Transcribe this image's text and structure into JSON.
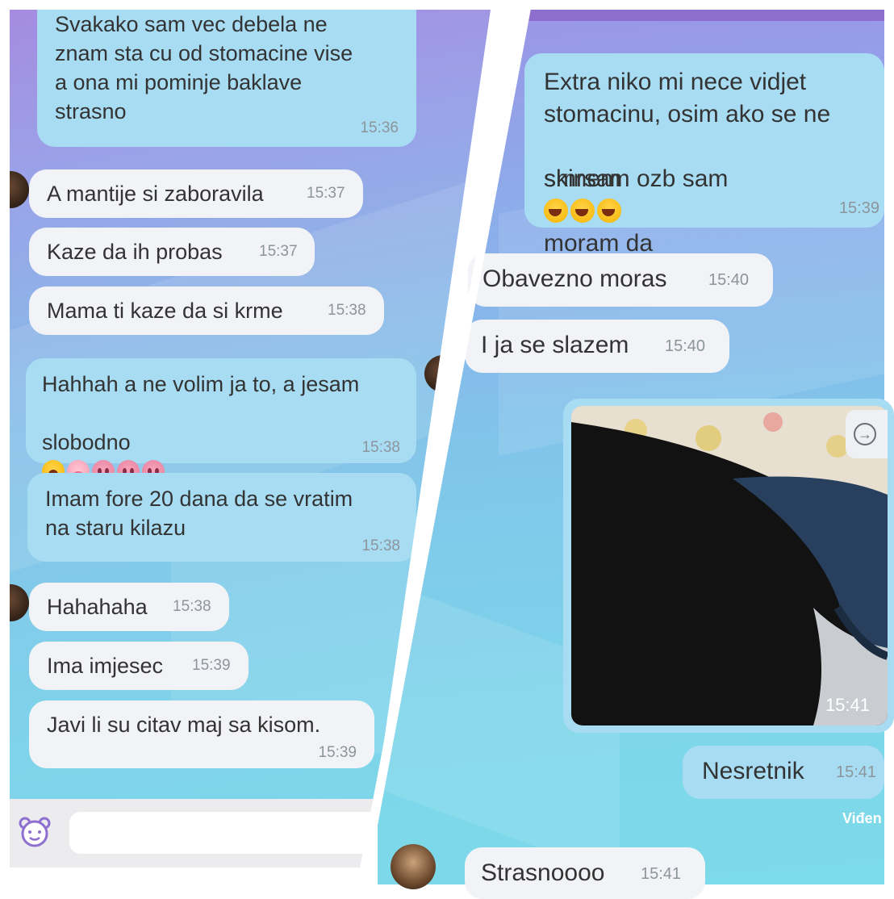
{
  "left_panel": {
    "messages": [
      {
        "text": "Svakako sam vec debela ne\nznam sta cu od stomacine vise\na ona mi pominje baklave\nstrasno",
        "time": "15:36"
      },
      {
        "text": "A mantije si zaboravila",
        "time": "15:37"
      },
      {
        "text": "Kaze da ih probas",
        "time": "15:37"
      },
      {
        "text": "Mama ti kaze da si krme",
        "time": "15:38"
      },
      {
        "text_line1": "Hahhah a ne volim ja to, a jesam",
        "text_line2": "slobodno",
        "time": "15:38"
      },
      {
        "text": "Imam fore 20 dana da se vratim\nna staru kilazu",
        "time": "15:38"
      },
      {
        "text": "Hahahaha",
        "time": "15:38"
      },
      {
        "text": "Ima imjesec",
        "time": "15:39"
      },
      {
        "text": "Javi li su citav maj sa kisom.",
        "time": "15:39"
      }
    ],
    "composer": {
      "icon": "sticker-bear-icon",
      "placeholder": ""
    }
  },
  "right_panel": {
    "messages": [
      {
        "text_line1": "Extra niko mi nece vidjet",
        "text_line2": "stomacinu, osim ako se ne",
        "text_line3a": "skinem",
        "text_line3b": "moram da",
        "text_line4": "smrsam ozb sam",
        "time": "15:39"
      },
      {
        "text": "Obavezno moras",
        "time": "15:40"
      },
      {
        "text": "I ja se slazem",
        "time": "15:40"
      },
      {
        "type": "photo",
        "time": "15:41"
      },
      {
        "text": "Nesretnik",
        "time": "15:41",
        "status": "Viđen"
      },
      {
        "text": "Strasnoooo",
        "time": "15:41"
      }
    ]
  },
  "colors": {
    "outgoing_bubble": "#a8dcf3",
    "incoming_bubble": "#f2f3f6",
    "accent_purple": "#8e6fd0"
  }
}
